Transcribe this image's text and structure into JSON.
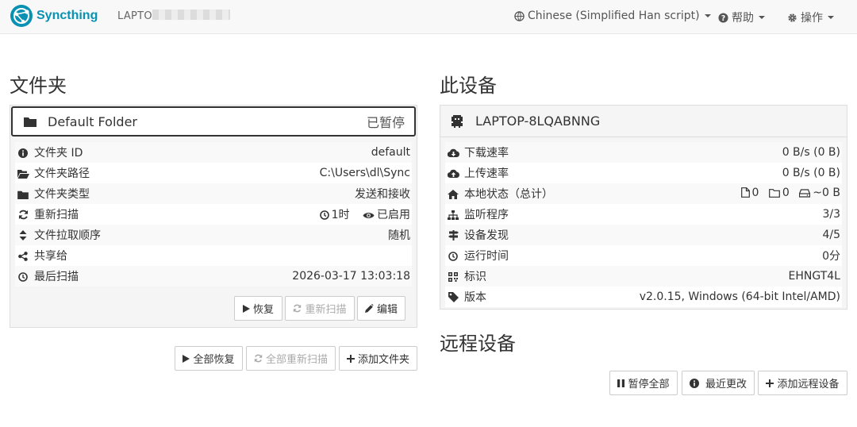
{
  "navbar": {
    "brand": "Syncthing",
    "device_name_visible": "LAPTO",
    "language": "Chinese (Simplified Han script)",
    "help": "帮助",
    "actions": "操作"
  },
  "folders": {
    "heading": "文件夹",
    "folder": {
      "name": "Default Folder",
      "status": "已暂停",
      "rows": {
        "id_label": "文件夹 ID",
        "id_value": "default",
        "path_label": "文件夹路径",
        "path_value": "C:\\Users\\dl\\Sync",
        "type_label": "文件夹类型",
        "type_value": "发送和接收",
        "rescan_label": "重新扫描",
        "rescan_interval": "1时",
        "rescan_watch": "已启用",
        "order_label": "文件拉取顺序",
        "order_value": "随机",
        "share_label": "共享给",
        "lastscan_label": "最后扫描",
        "lastscan_value": "2026-03-17 13:03:18"
      },
      "buttons": {
        "resume": "恢复",
        "rescan": "重新扫描",
        "edit": "编辑"
      }
    },
    "buttons": {
      "resume_all": "全部恢复",
      "rescan_all": "全部重新扫描",
      "add_folder": "添加文件夹"
    }
  },
  "this_device": {
    "heading": "此设备",
    "name": "LAPTOP-8LQABNNG",
    "rows": {
      "download_label": "下载速率",
      "download_value": "0 B/s (0 B)",
      "upload_label": "上传速率",
      "upload_value": "0 B/s (0 B)",
      "local_label": "本地状态（总计）",
      "local_files": "0",
      "local_dirs": "0",
      "local_size": "~0 B",
      "listeners_label": "监听程序",
      "listeners_value": "3/3",
      "discovery_label": "设备发现",
      "discovery_value": "4/5",
      "uptime_label": "运行时间",
      "uptime_value": "0分",
      "id_label": "标识",
      "id_value": "EHNGT4L",
      "version_label": "版本",
      "version_value": "v2.0.15, Windows (64-bit Intel/AMD)"
    }
  },
  "remote_devices": {
    "heading": "远程设备",
    "buttons": {
      "pause_all": "暂停全部",
      "recent_changes": "最近更改",
      "add_device": "添加远程设备"
    }
  },
  "colors": {
    "brand": "#0891b2",
    "link": "#2a9fd6",
    "success": "#3bb04a"
  },
  "icons": [
    "syncthing-logo-icon",
    "globe-icon",
    "question-circle-icon",
    "gear-icon",
    "folder-icon",
    "info-circle-icon",
    "folder-open-icon",
    "refresh-icon",
    "sort-icon",
    "share-icon",
    "clock-icon",
    "play-icon",
    "pencil-icon",
    "plus-icon",
    "device-icon",
    "cloud-download-icon",
    "cloud-upload-icon",
    "home-icon",
    "sitemap-icon",
    "signpost-icon",
    "qrcode-icon",
    "tag-icon",
    "pause-icon",
    "file-icon",
    "hdd-icon",
    "eye-icon"
  ]
}
